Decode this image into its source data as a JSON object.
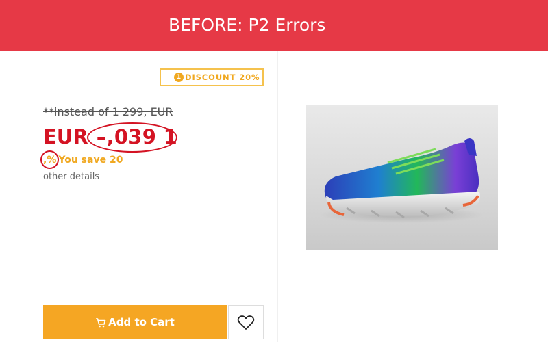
{
  "banner": {
    "title": "BEFORE: P2 Errors",
    "color": "#e63946"
  },
  "product": {
    "discount_badge": {
      "icon": "coin-icon",
      "coin_label": "1",
      "text": "DISCOUNT 20%"
    },
    "old_price": "**instead of 1 299,   EUR",
    "price": {
      "currency": "EUR",
      "value": "–,039 1"
    },
    "savings": {
      "prefix": ",%",
      "text": "You save 20"
    },
    "other_details": "other details",
    "image": {
      "icon": "sneaker-image"
    }
  },
  "actions": {
    "add_to_cart_label": "Add to Cart",
    "cart_icon": "cart-icon",
    "wishlist_icon": "heart-icon"
  },
  "colors": {
    "price_red": "#d41323",
    "accent_orange": "#f5a623",
    "badge_border": "#f5c24d"
  }
}
